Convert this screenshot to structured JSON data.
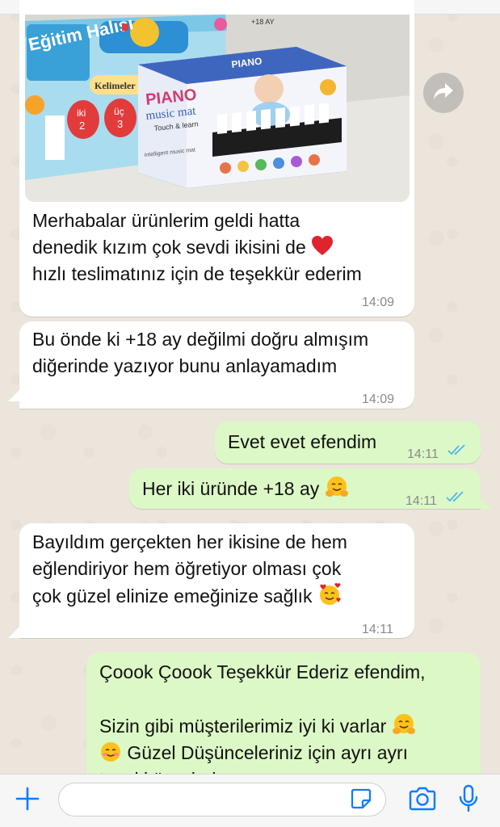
{
  "messages": [
    {
      "id": "m1",
      "direction": "incoming",
      "has_photo": true,
      "photo_text": {
        "box1_title": "Eğitim Halısı",
        "box1_label": "Kelimeler",
        "box1_nums": [
          "iki",
          "2",
          "üç",
          "3"
        ],
        "box1_age": "+18 AY",
        "box2_title": "PIANO",
        "box2_subtitle": "music mat",
        "box2_tagline": "Touch & learn",
        "box2_small": "intelligent music mat"
      },
      "lines": [
        "Merhabalar ürünlerim geldi hatta",
        "denedik kızım çok sevdi ikisini de",
        "hızlı teslimatınız için de teşekkür ederim"
      ],
      "time": "14:09"
    },
    {
      "id": "m2",
      "direction": "incoming",
      "lines": [
        "Bu önde ki +18 ay değilmi doğru almışım",
        "diğerinde yazıyor bunu anlayamadım"
      ],
      "time": "14:09"
    },
    {
      "id": "m3",
      "direction": "outgoing",
      "lines": [
        "Evet evet efendim"
      ],
      "time": "14:11"
    },
    {
      "id": "m4",
      "direction": "outgoing",
      "lines": [
        "Her iki üründe +18 ay"
      ],
      "time": "14:11"
    },
    {
      "id": "m5",
      "direction": "incoming",
      "lines": [
        "Bayıldım gerçekten her ikisine de hem",
        "eğlendiriyor hem öğretiyor olması çok",
        "çok güzel elinize emeğinize sağlık"
      ],
      "time": "14:11"
    },
    {
      "id": "m6",
      "direction": "outgoing",
      "lines": [
        "Çoook Çoook Teşekkür Ederiz efendim,",
        "",
        "Sizin gibi müşterilerimiz iyi ki varlar",
        "Güzel Düşünceleriniz için ayrı ayrı",
        "teşekkür ederiz"
      ]
    }
  ],
  "icons": {
    "forward": "forward-arrow-icon",
    "ticks": "double-check-icon",
    "plus": "plus-icon",
    "sticker": "sticker-icon",
    "camera": "camera-icon",
    "mic": "microphone-icon",
    "heart": "red-heart-emoji",
    "hug": "hugging-face-emoji",
    "hearts_face": "smiling-face-with-hearts-emoji",
    "smile": "smiling-face-emoji"
  },
  "input": {
    "placeholder": ""
  },
  "colors": {
    "incoming_bubble": "#ffffff",
    "outgoing_bubble": "#dcf8c6",
    "read_ticks": "#4fb6ec",
    "accent": "#0a7cff",
    "chat_bg": "#ece5dc"
  }
}
